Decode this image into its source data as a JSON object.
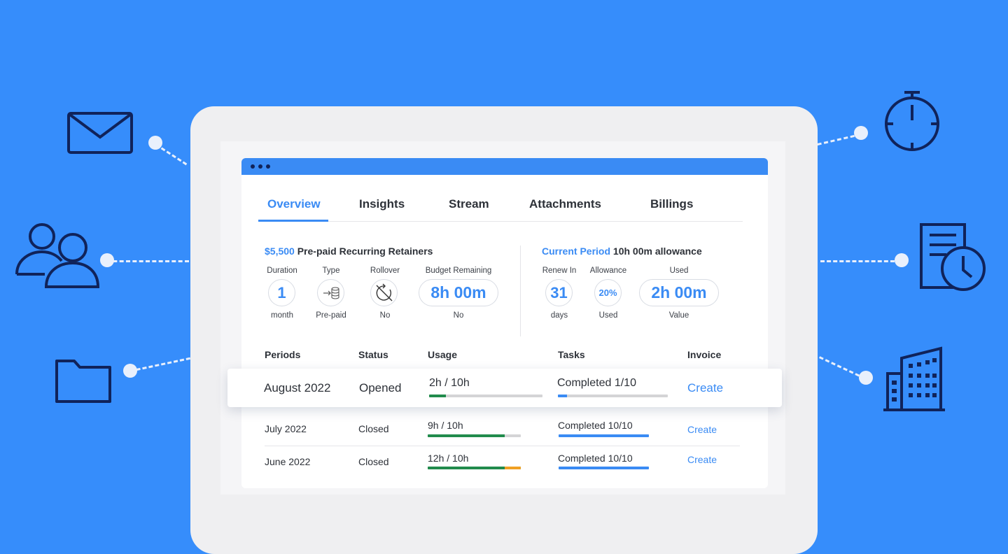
{
  "colors": {
    "background": "#368dfb",
    "accent": "#3a8bf4",
    "green": "#218b4c",
    "orange": "#f0a024",
    "icon_stroke": "#10235a"
  },
  "decor_icons": [
    "envelope-icon",
    "users-icon",
    "folder-icon",
    "stopwatch-icon",
    "document-clock-icon",
    "building-icon"
  ],
  "tabs": [
    "Overview",
    "Insights",
    "Stream",
    "Attachments",
    "Billings"
  ],
  "active_tab": "Overview",
  "retainer": {
    "amount": "$5,500",
    "title": "Pre-paid Recurring Retainers",
    "duration": {
      "label": "Duration",
      "value": "1",
      "sub": "month"
    },
    "type": {
      "label": "Type",
      "icon": "prepaid-coins-icon",
      "sub": "Pre-paid"
    },
    "rollover": {
      "label": "Rollover",
      "icon": "rollover-disabled-icon",
      "sub": "No"
    },
    "budget": {
      "label": "Budget Remaining",
      "value": "8h 00m",
      "sub": "No"
    }
  },
  "period": {
    "heading": "Current Period",
    "allowance_text": "10h 00m allowance",
    "renew": {
      "label": "Renew In",
      "value": "31",
      "sub": "days"
    },
    "allowance": {
      "label": "Allowance",
      "value": "20%",
      "sub": "Used"
    },
    "used": {
      "label": "Used",
      "value": "2h 00m",
      "sub": "Value"
    }
  },
  "table": {
    "headers": [
      "Periods",
      "Status",
      "Usage",
      "Tasks",
      "Invoice"
    ],
    "rows": [
      {
        "period": "August 2022",
        "status": "Opened",
        "usage": "2h / 10h",
        "usage_fraction": 0.15,
        "tasks": "Completed 1/10",
        "tasks_fraction": 0.08,
        "invoice": "Create"
      },
      {
        "period": "July 2022",
        "status": "Closed",
        "usage": "9h / 10h",
        "usage_fraction": 0.83,
        "tasks": "Completed 10/10",
        "tasks_fraction": 1.0,
        "invoice": "Create"
      },
      {
        "period": "June 2022",
        "status": "Closed",
        "usage": "12h / 10h",
        "usage_fraction": 1.0,
        "usage_over_fraction": 0.17,
        "tasks": "Completed 10/10",
        "tasks_fraction": 1.0,
        "invoice": "Create"
      }
    ]
  }
}
